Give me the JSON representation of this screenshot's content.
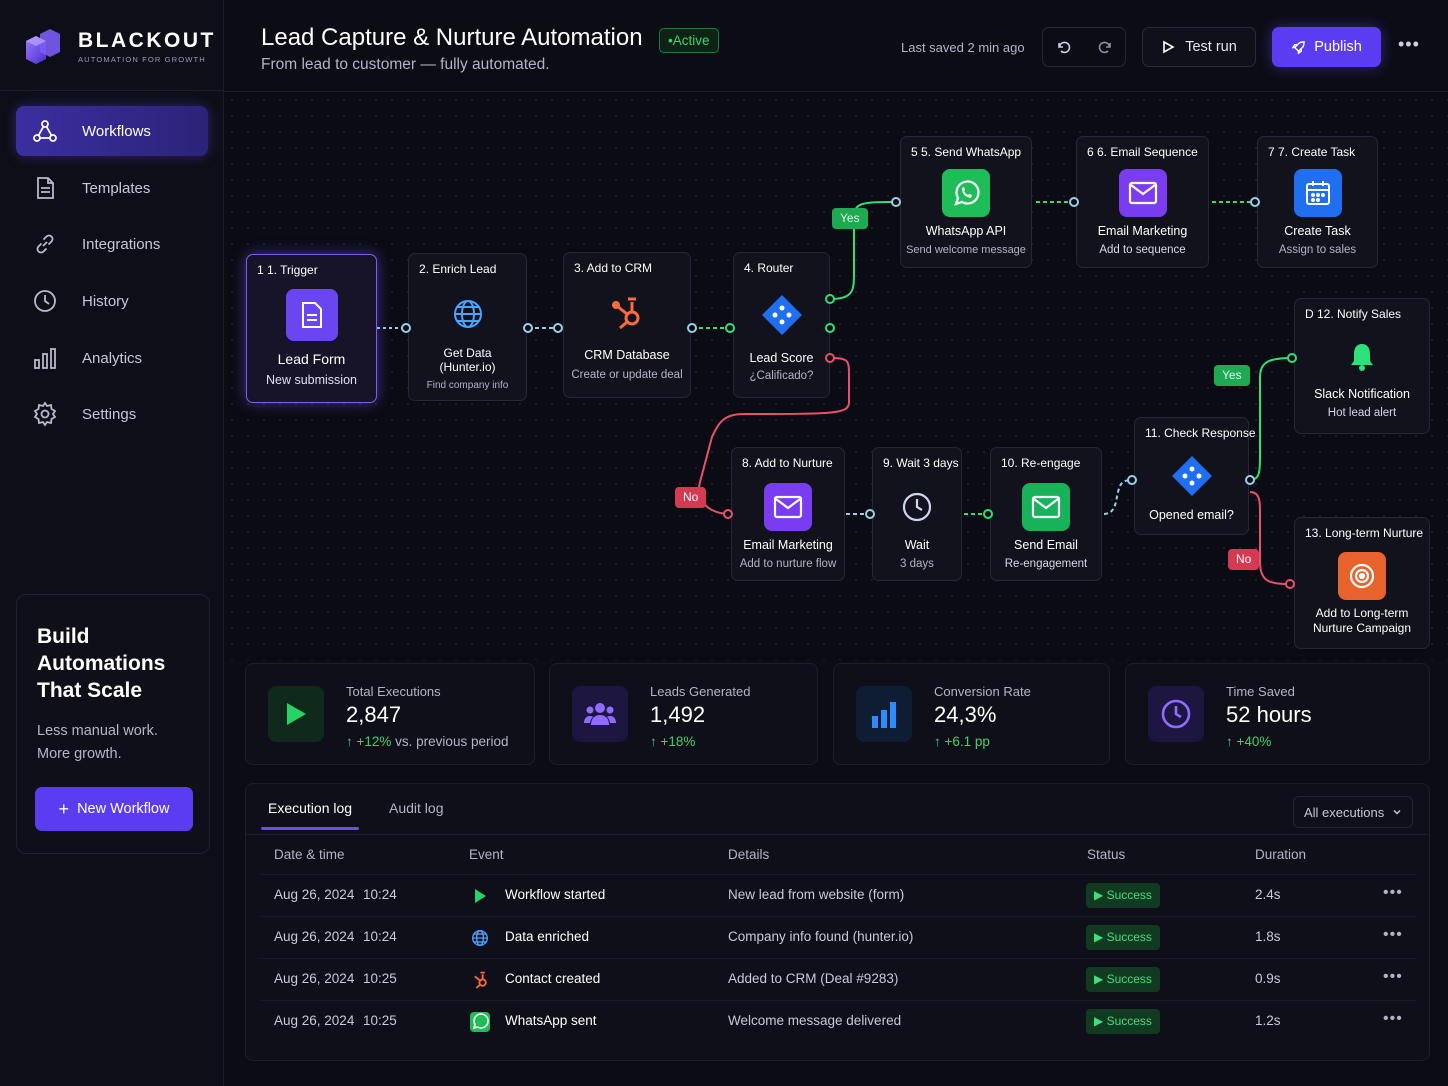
{
  "brand": {
    "name": "BLACKOUT",
    "tagline": "AUTOMATION FOR GROWTH"
  },
  "nav": [
    {
      "label": "Workflows",
      "icon": "workflow-icon"
    },
    {
      "label": "Templates",
      "icon": "document-icon"
    },
    {
      "label": "Integrations",
      "icon": "link-icon"
    },
    {
      "label": "History",
      "icon": "clock-icon"
    },
    {
      "label": "Analytics",
      "icon": "bar-chart-icon"
    },
    {
      "label": "Settings",
      "icon": "gear-icon"
    }
  ],
  "promo": {
    "title": "Build Automations That Scale",
    "text": "Less manual work.\nMore growth.",
    "button": "New Workflow"
  },
  "header": {
    "title": "Lead Capture & Nurture Automation",
    "status": "•Active",
    "subtitle": "From lead to customer — fully automated.",
    "saved": "Last saved 2 min ago",
    "test_label": "Test run",
    "publish_label": "Publish"
  },
  "nodes": {
    "n1": {
      "header": "1  1. Trigger",
      "title": "Lead Form",
      "sub": "New submission"
    },
    "n2": {
      "header": "2. Enrich Lead",
      "title": "Get Data (Hunter.io)",
      "sub": "Find company info"
    },
    "n3": {
      "header": "3. Add to CRM",
      "title": "CRM Database",
      "sub": "Create or update deal"
    },
    "n4": {
      "header": "4. Router",
      "title": "Lead Score",
      "sub": "¿Calificado?"
    },
    "n5": {
      "header": "5  5. Send WhatsApp",
      "title": "WhatsApp API",
      "sub": "Send welcome message"
    },
    "n6": {
      "header": "6  6. Email Sequence",
      "title": "Email Marketing",
      "sub": "Add to sequence"
    },
    "n7": {
      "header": "7  7. Create Task",
      "title": "Create Task",
      "sub": "Assign to sales"
    },
    "n8": {
      "header": "8. Add to Nurture",
      "title": "Email Marketing",
      "sub": "Add to nurture flow"
    },
    "n9": {
      "header": "9. Wait 3 days",
      "title": "Wait",
      "sub": "3 days"
    },
    "n10": {
      "header": "10. Re-engage",
      "title": "Send Email",
      "sub": "Re-engagement"
    },
    "n11": {
      "header": "11. Check Response",
      "title": "Opened email?",
      "sub": ""
    },
    "n12": {
      "header": "D  12. Notify Sales",
      "title": "Slack Notification",
      "sub": "Hot lead alert"
    },
    "n13": {
      "header": "13. Long-term Nurture",
      "title": "Add to Long-term Nurture Campaign",
      "sub": ""
    }
  },
  "branch_labels": {
    "yes1": "Yes",
    "no1": "No",
    "yes2": "Yes",
    "no2": "No"
  },
  "stats": [
    {
      "label": "Total Executions",
      "value": "2,847",
      "delta": "↑ +12%",
      "delta_note": "vs. previous period",
      "icon": "play-icon"
    },
    {
      "label": "Leads Generated",
      "value": "1,492",
      "delta": "↑ +18%",
      "delta_note": "",
      "icon": "users-icon"
    },
    {
      "label": "Conversion Rate",
      "value": "24,3%",
      "delta": "↑ +6.1 pp",
      "delta_note": "",
      "icon": "bar-chart-icon"
    },
    {
      "label": "Time Saved",
      "value": "52 hours",
      "delta": "↑ +40%",
      "delta_note": "",
      "icon": "clock-icon"
    }
  ],
  "log": {
    "tabs": [
      "Execution log",
      "Audit log"
    ],
    "filter": "All executions",
    "columns": [
      "Date & time",
      "Event",
      "Details",
      "Status",
      "Duration"
    ],
    "rows": [
      {
        "date": "Aug 26, 2024",
        "time": "10:24",
        "event": "Workflow started",
        "details": "New lead from website (form)",
        "status": "Success",
        "duration": "2.4s",
        "icon": "play-icon"
      },
      {
        "date": "Aug 26, 2024",
        "time": "10:24",
        "event": "Data enriched",
        "details": "Company info found (hunter.io)",
        "status": "Success",
        "duration": "1.8s",
        "icon": "globe-icon"
      },
      {
        "date": "Aug 26, 2024",
        "time": "10:25",
        "event": "Contact created",
        "details": "Added to CRM (Deal #9283)",
        "status": "Success",
        "duration": "0.9s",
        "icon": "hubspot-icon"
      },
      {
        "date": "Aug 26, 2024",
        "time": "10:25",
        "event": "WhatsApp sent",
        "details": "Welcome message delivered",
        "status": "Success",
        "duration": "1.2s",
        "icon": "whatsapp-icon"
      }
    ]
  },
  "colors": {
    "accent": "#5b3cf0",
    "success": "#37d66a",
    "danger": "#d63a52",
    "yes": "#1eaa52"
  }
}
